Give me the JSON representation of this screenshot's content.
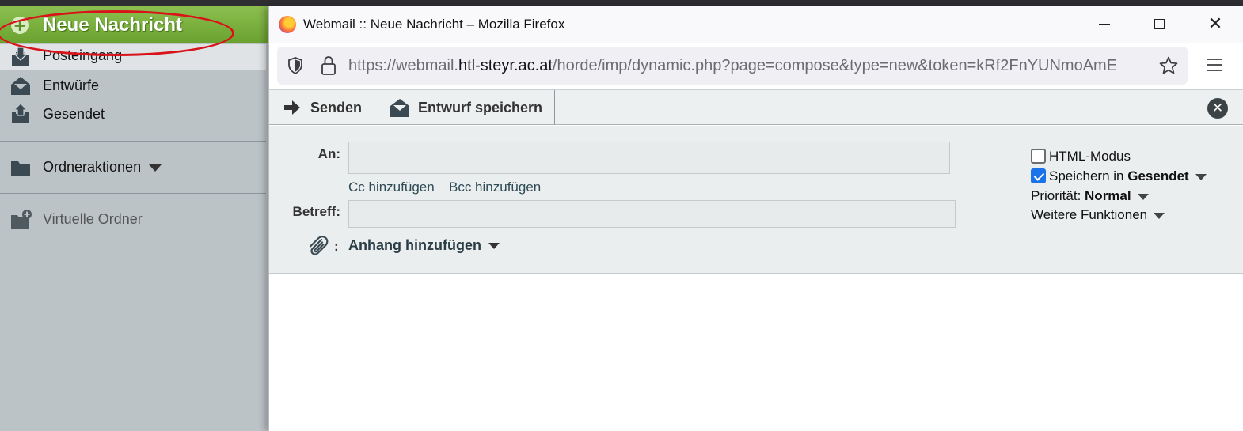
{
  "sidebar": {
    "new_message": "Neue Nachricht",
    "items": [
      {
        "label": "Posteingang",
        "icon": "inbox-icon"
      },
      {
        "label": "Entwürfe",
        "icon": "drafts-icon"
      },
      {
        "label": "Gesendet",
        "icon": "sent-icon"
      }
    ],
    "folder_actions": "Ordneraktionen",
    "virtual_folders": "Virtuelle Ordner"
  },
  "window": {
    "title": "Webmail :: Neue Nachricht – Mozilla Firefox",
    "url_prefix": "https://webmail.",
    "url_domain": "htl-steyr.ac.at",
    "url_path": "/horde/imp/dynamic.php?page=compose&type=new&token=kRf2FnYUNmoAmE"
  },
  "toolbar": {
    "send_label": "Senden",
    "draft_label": "Entwurf speichern"
  },
  "compose": {
    "to_label": "An:",
    "to_value": "",
    "cc_link": "Cc hinzufügen",
    "bcc_link": "Bcc hinzufügen",
    "subject_label": "Betreff:",
    "subject_value": "",
    "attach_colon": ":",
    "attach_label": "Anhang hinzufügen",
    "body": ""
  },
  "options": {
    "html_mode": {
      "label": "HTML-Modus",
      "checked": false
    },
    "save_sent": {
      "label": "Speichern in ",
      "folder": "Gesendet",
      "checked": true
    },
    "priority_label": "Priorität:",
    "priority_value": "Normal",
    "more": "Weitere Funktionen"
  },
  "colors": {
    "new_message_green": "#6aa12f",
    "highlight_ellipse": "#d8141a",
    "checkbox_blue": "#1a73e8"
  }
}
